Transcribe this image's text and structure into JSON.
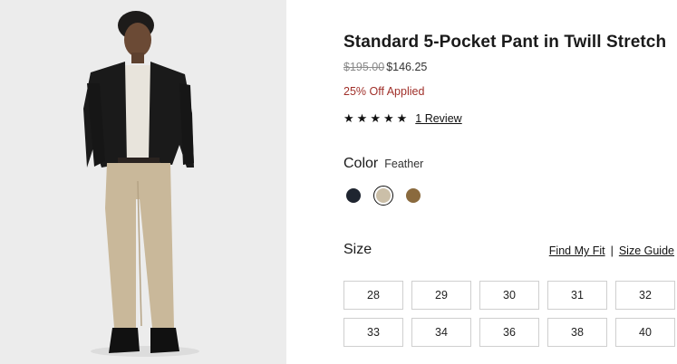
{
  "product": {
    "title": "Standard 5-Pocket Pant in Twill Stretch",
    "price_original": "$195.00",
    "price_sale": "$146.25",
    "discount_text": "25% Off Applied"
  },
  "rating": {
    "stars": 5,
    "star_glyph": "★",
    "review_link": "1 Review"
  },
  "color": {
    "label": "Color",
    "selected_name": "Feather",
    "swatches": [
      {
        "name": "navy",
        "hex": "#1f2530",
        "selected": false
      },
      {
        "name": "Feather",
        "hex": "#cbbfa8",
        "selected": true
      },
      {
        "name": "olive-brown",
        "hex": "#8a6a3e",
        "selected": false
      }
    ]
  },
  "size": {
    "label": "Size",
    "find_my_fit": "Find My Fit",
    "separator": "|",
    "size_guide": "Size Guide",
    "options": [
      "28",
      "29",
      "30",
      "31",
      "32",
      "33",
      "34",
      "36",
      "38",
      "40"
    ]
  },
  "colors": {
    "discount": "#a0302a",
    "image_background": "#ececec"
  }
}
